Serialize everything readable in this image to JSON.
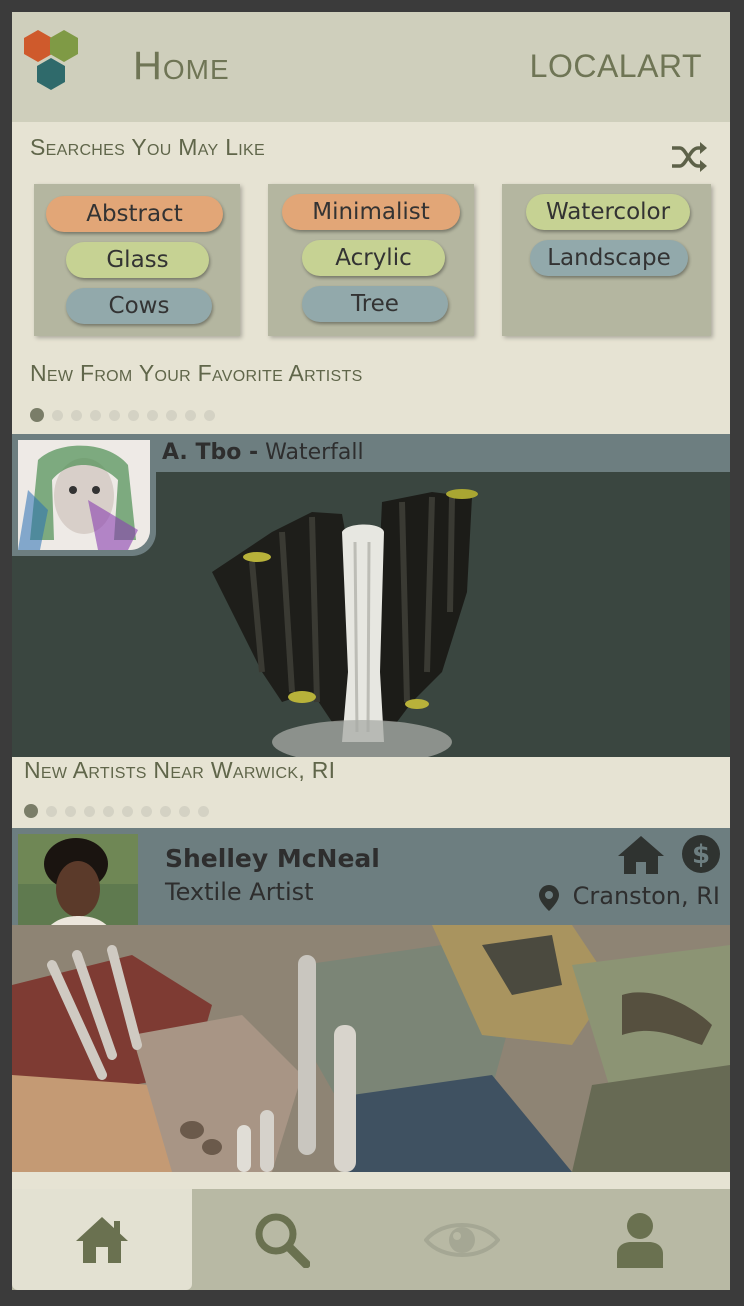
{
  "header": {
    "title": "Home",
    "brand": "LOCALART",
    "logo_colors": [
      "#cf5a2c",
      "#7f9a45",
      "#2f6a6b"
    ]
  },
  "searches": {
    "title": "Searches You May Like",
    "groups": [
      [
        "Abstract",
        "Glass",
        "Cows"
      ],
      [
        "Minimalist",
        "Acrylic",
        "Tree"
      ],
      [
        "Watercolor",
        "Landscape"
      ]
    ]
  },
  "favorites": {
    "title": "New From Your Favorite Artists",
    "carousel_index": 1,
    "carousel_total": 10,
    "artist": "A. Tbo -",
    "work": "Waterfall"
  },
  "nearby": {
    "title": "New Artists Near Warwick, RI",
    "carousel_index": 1,
    "carousel_total": 10,
    "artist_name": "Shelley McNeal",
    "artist_role": "Textile Artist",
    "location": "Cranston, RI"
  },
  "nav": {
    "items": [
      "home-icon",
      "search-icon",
      "eye-icon",
      "user-icon"
    ],
    "active": "home-icon"
  },
  "colors": {
    "accent_orange": "#e2a677",
    "accent_green": "#c6d293",
    "accent_blue": "#92a9ab",
    "bar_slate": "#6d7e80",
    "text_olive": "#6f7555"
  }
}
